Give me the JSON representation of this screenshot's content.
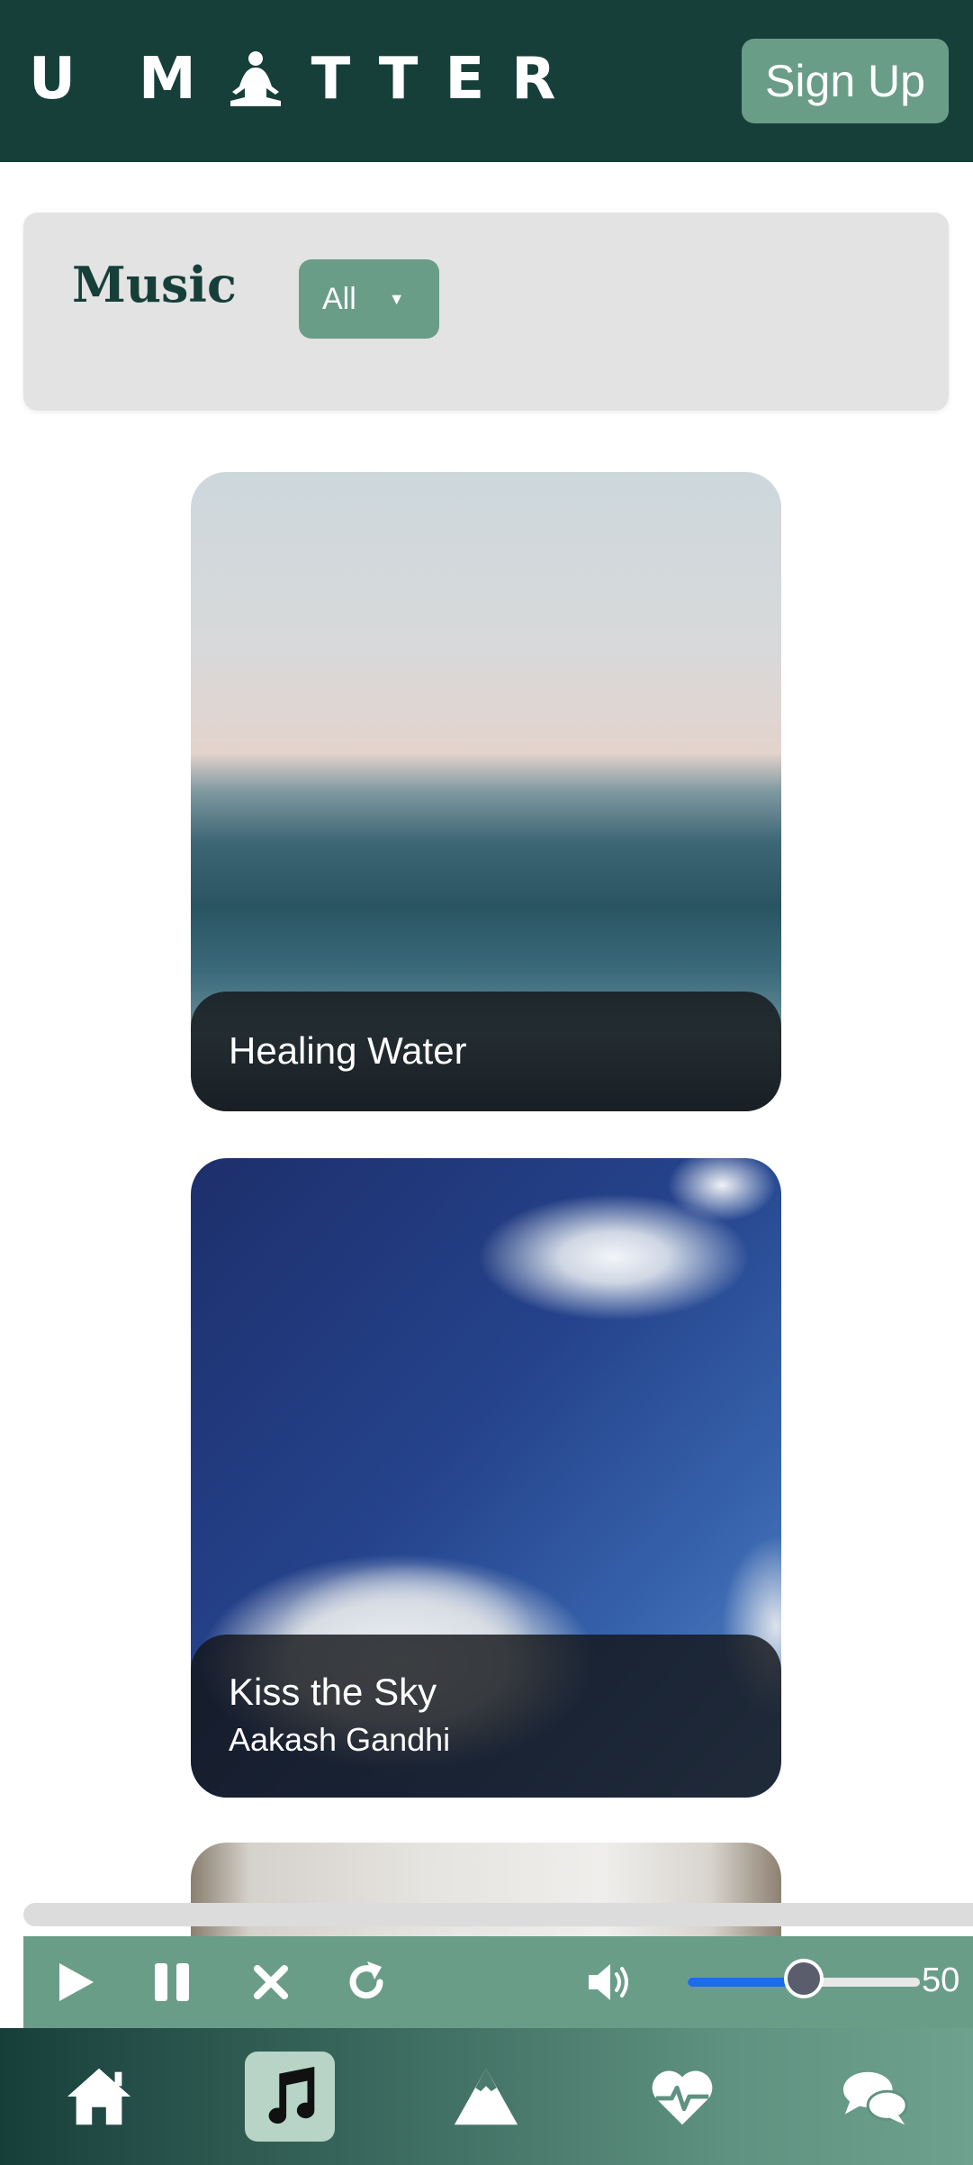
{
  "header": {
    "logo_before": "U",
    "logo_after": "TTER",
    "logo_m": "M",
    "signup_label": "Sign Up"
  },
  "music_bar": {
    "title": "Music",
    "filter_value": "All"
  },
  "tracks": [
    {
      "title": "Healing Water",
      "artist": ""
    },
    {
      "title": "Kiss the Sky",
      "artist": "Aakash Gandhi"
    }
  ],
  "player": {
    "volume": 50,
    "volume_text": "50",
    "controls": [
      "play-icon",
      "pause-icon",
      "close-icon",
      "replay-icon",
      "volume-icon"
    ]
  },
  "nav": {
    "items": [
      "home-icon",
      "music-note-icon",
      "mountain-icon",
      "heartbeat-icon",
      "chat-icon"
    ],
    "active": "music-note-icon"
  },
  "colors": {
    "header_bg": "#173f3a",
    "accent": "#6a9d88",
    "slider_fill": "#1a6ce8"
  }
}
